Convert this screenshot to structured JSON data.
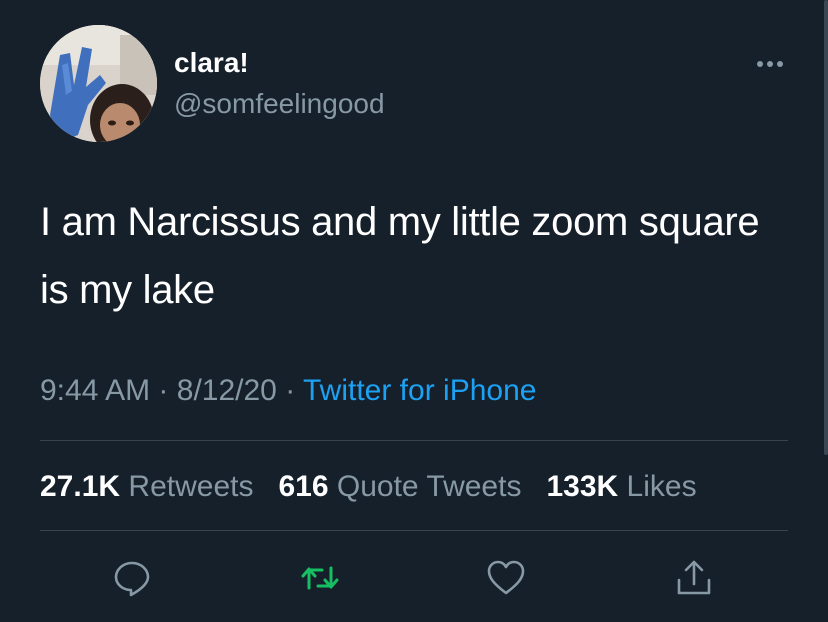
{
  "user": {
    "display_name": "clara!",
    "handle": "@somfeelingood"
  },
  "tweet": {
    "text": "I am Narcissus and my little zoom square is my lake",
    "time": "9:44 AM",
    "separator": "·",
    "date": "8/12/20",
    "source": "Twitter for iPhone"
  },
  "stats": {
    "retweets_count": "27.1K",
    "retweets_label": "Retweets",
    "quotes_count": "616",
    "quotes_label": "Quote Tweets",
    "likes_count": "133K",
    "likes_label": "Likes"
  },
  "icons": {
    "more": "more-icon",
    "reply": "reply-icon",
    "retweet": "retweet-icon",
    "like": "heart-icon",
    "share": "share-icon"
  },
  "colors": {
    "background": "#15202b",
    "secondary_text": "#8899a6",
    "link": "#1da1f2",
    "retweet_active": "#17bf63",
    "divider": "#38444d"
  }
}
